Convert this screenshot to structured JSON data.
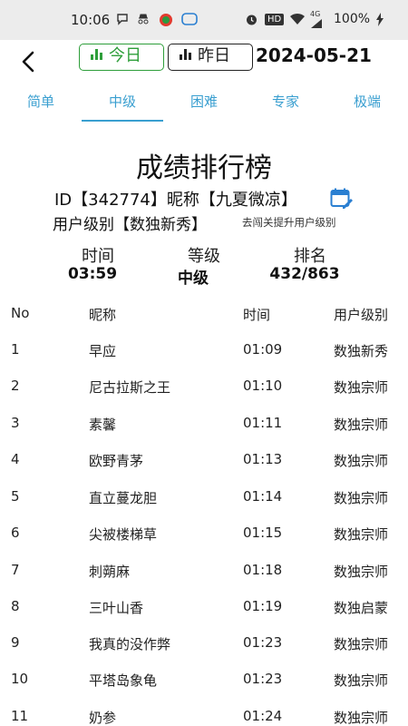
{
  "status_bar": {
    "time": "10:06",
    "icons": [
      "chat-bubble-icon",
      "incognito-icon",
      "app-icon",
      "message-icon",
      "alarm-icon",
      "hd-icon",
      "wifi-icon",
      "signal-4g-icon",
      "charging-icon"
    ],
    "hd": "HD",
    "network": "4G",
    "battery": "100%"
  },
  "header": {
    "today_label": "今日",
    "yesterday_label": "昨日",
    "date": "2024-05-21",
    "accent_color": "#2e9e3a"
  },
  "tabs": [
    {
      "label": "简单"
    },
    {
      "label": "中级"
    },
    {
      "label": "困难"
    },
    {
      "label": "专家"
    },
    {
      "label": "极端"
    }
  ],
  "active_tab": "中级",
  "tab_color": "#3a9fd0",
  "title": "成绩排行榜",
  "profile": {
    "id_text": "ID【342774】昵称【九夏微凉】",
    "level_text": "用户级别【数独新秀】",
    "upgrade_link": "去闯关提升用户级别"
  },
  "stats": {
    "time_label": "时间",
    "time_value": "03:59",
    "grade_label": "等级",
    "grade_value": "中级",
    "rank_label": "排名",
    "rank_value": "432/863"
  },
  "table": {
    "headers": [
      "No",
      "昵称",
      "时间",
      "用户级别"
    ],
    "rows": [
      {
        "no": "1",
        "name": "早应",
        "time": "01:09",
        "level": "数独新秀"
      },
      {
        "no": "2",
        "name": "尼古拉斯之王",
        "time": "01:10",
        "level": "数独宗师"
      },
      {
        "no": "3",
        "name": "素馨",
        "time": "01:11",
        "level": "数独宗师"
      },
      {
        "no": "4",
        "name": "欧野青茅",
        "time": "01:13",
        "level": "数独宗师"
      },
      {
        "no": "5",
        "name": "直立蔓龙胆",
        "time": "01:14",
        "level": "数独宗师"
      },
      {
        "no": "6",
        "name": "尖被楼梯草",
        "time": "01:15",
        "level": "数独宗师"
      },
      {
        "no": "7",
        "name": "刺蒴麻",
        "time": "01:18",
        "level": "数独宗师"
      },
      {
        "no": "8",
        "name": "三叶山香",
        "time": "01:19",
        "level": "数独启蒙"
      },
      {
        "no": "9",
        "name": "我真的没作弊",
        "time": "01:23",
        "level": "数独宗师"
      },
      {
        "no": "10",
        "name": "平塔岛象龟",
        "time": "01:23",
        "level": "数独宗师"
      },
      {
        "no": "11",
        "name": "奶参",
        "time": "01:24",
        "level": "数独宗师"
      }
    ]
  }
}
